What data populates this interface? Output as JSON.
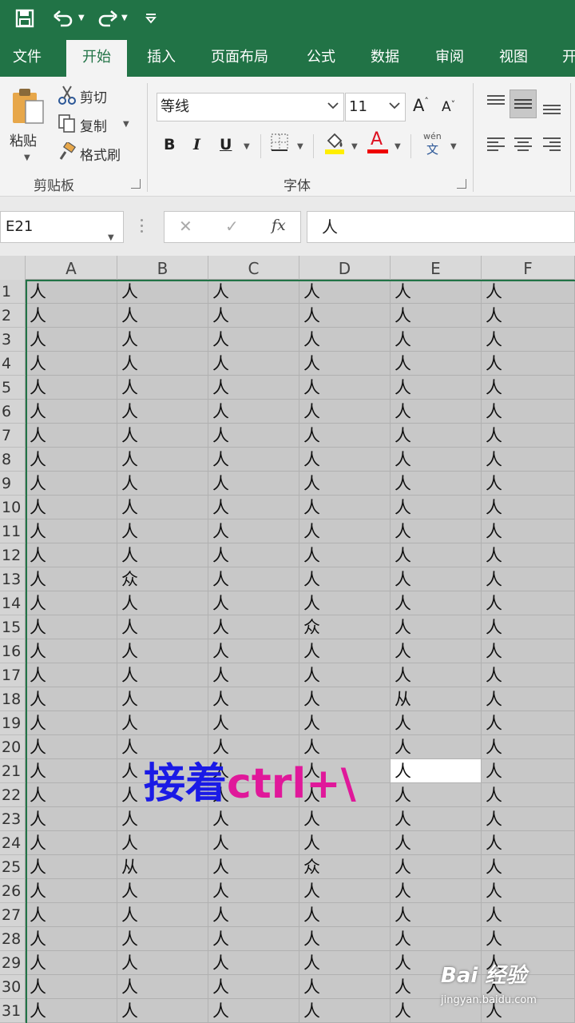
{
  "quick_access": {
    "save": "save-icon",
    "undo": "undo-icon",
    "redo": "redo-icon",
    "customize": "customize-icon"
  },
  "tabs": [
    "文件",
    "开始",
    "插入",
    "页面布局",
    "公式",
    "数据",
    "审阅",
    "视图",
    "开"
  ],
  "active_tab": "开始",
  "ribbon": {
    "clipboard": {
      "paste": "粘贴",
      "cut": "剪切",
      "copy": "复制",
      "format_painter": "格式刷",
      "group_label": "剪贴板"
    },
    "font": {
      "name": "等线",
      "size": "11",
      "group_label": "字体",
      "bold": "B",
      "italic": "I",
      "underline": "U",
      "grow": "A",
      "shrink": "A",
      "phonetic_top": "wén",
      "phonetic_bottom": "文",
      "font_color": "A"
    }
  },
  "formula_bar": {
    "name_box": "E21",
    "cancel": "✕",
    "enter": "✓",
    "fx": "fx",
    "content": "人"
  },
  "columns": [
    "A",
    "B",
    "C",
    "D",
    "E",
    "F"
  ],
  "rows": [
    {
      "n": "1",
      "cells": [
        "人",
        "人",
        "人",
        "人",
        "人",
        "人"
      ]
    },
    {
      "n": "2",
      "cells": [
        "人",
        "人",
        "人",
        "人",
        "人",
        "人"
      ]
    },
    {
      "n": "3",
      "cells": [
        "人",
        "人",
        "人",
        "人",
        "人",
        "人"
      ]
    },
    {
      "n": "4",
      "cells": [
        "人",
        "人",
        "人",
        "人",
        "人",
        "人"
      ]
    },
    {
      "n": "5",
      "cells": [
        "人",
        "人",
        "人",
        "人",
        "人",
        "人"
      ]
    },
    {
      "n": "6",
      "cells": [
        "人",
        "人",
        "人",
        "人",
        "人",
        "人"
      ]
    },
    {
      "n": "7",
      "cells": [
        "人",
        "人",
        "人",
        "人",
        "人",
        "人"
      ]
    },
    {
      "n": "8",
      "cells": [
        "人",
        "人",
        "人",
        "人",
        "人",
        "人"
      ]
    },
    {
      "n": "9",
      "cells": [
        "人",
        "人",
        "人",
        "人",
        "人",
        "人"
      ]
    },
    {
      "n": "10",
      "cells": [
        "人",
        "人",
        "人",
        "人",
        "人",
        "人"
      ]
    },
    {
      "n": "11",
      "cells": [
        "人",
        "人",
        "人",
        "人",
        "人",
        "人"
      ]
    },
    {
      "n": "12",
      "cells": [
        "人",
        "人",
        "人",
        "人",
        "人",
        "人"
      ]
    },
    {
      "n": "13",
      "cells": [
        "人",
        "众",
        "人",
        "人",
        "人",
        "人"
      ]
    },
    {
      "n": "14",
      "cells": [
        "人",
        "人",
        "人",
        "人",
        "人",
        "人"
      ]
    },
    {
      "n": "15",
      "cells": [
        "人",
        "人",
        "人",
        "众",
        "人",
        "人"
      ]
    },
    {
      "n": "16",
      "cells": [
        "人",
        "人",
        "人",
        "人",
        "人",
        "人"
      ]
    },
    {
      "n": "17",
      "cells": [
        "人",
        "人",
        "人",
        "人",
        "人",
        "人"
      ]
    },
    {
      "n": "18",
      "cells": [
        "人",
        "人",
        "人",
        "人",
        "从",
        "人"
      ]
    },
    {
      "n": "19",
      "cells": [
        "人",
        "人",
        "人",
        "人",
        "人",
        "人"
      ]
    },
    {
      "n": "20",
      "cells": [
        "人",
        "人",
        "人",
        "人",
        "人",
        "人"
      ]
    },
    {
      "n": "21",
      "cells": [
        "人",
        "人",
        "人",
        "人",
        "人",
        "人"
      ]
    },
    {
      "n": "22",
      "cells": [
        "人",
        "人",
        "人",
        "人",
        "人",
        "人"
      ]
    },
    {
      "n": "23",
      "cells": [
        "人",
        "人",
        "人",
        "人",
        "人",
        "人"
      ]
    },
    {
      "n": "24",
      "cells": [
        "人",
        "人",
        "人",
        "人",
        "人",
        "人"
      ]
    },
    {
      "n": "25",
      "cells": [
        "人",
        "从",
        "人",
        "众",
        "人",
        "人"
      ]
    },
    {
      "n": "26",
      "cells": [
        "人",
        "人",
        "人",
        "人",
        "人",
        "人"
      ]
    },
    {
      "n": "27",
      "cells": [
        "人",
        "人",
        "人",
        "人",
        "人",
        "人"
      ]
    },
    {
      "n": "28",
      "cells": [
        "人",
        "人",
        "人",
        "人",
        "人",
        "人"
      ]
    },
    {
      "n": "29",
      "cells": [
        "人",
        "人",
        "人",
        "人",
        "人",
        "人"
      ]
    },
    {
      "n": "30",
      "cells": [
        "人",
        "人",
        "人",
        "人",
        "人",
        "人"
      ]
    },
    {
      "n": "31",
      "cells": [
        "人",
        "人",
        "人",
        "人",
        "人",
        "人"
      ]
    }
  ],
  "active_cell": "E21",
  "caption": {
    "part1": "接着",
    "part2": "ctrl+\\"
  },
  "watermark": {
    "logo": "Bai 经验",
    "url": "jingyan.baidu.com"
  },
  "colors": {
    "excel_green": "#217346",
    "caption_blue": "#1a1ae6",
    "caption_pink": "#e0189a",
    "selection_gray": "#c8c8c8"
  }
}
